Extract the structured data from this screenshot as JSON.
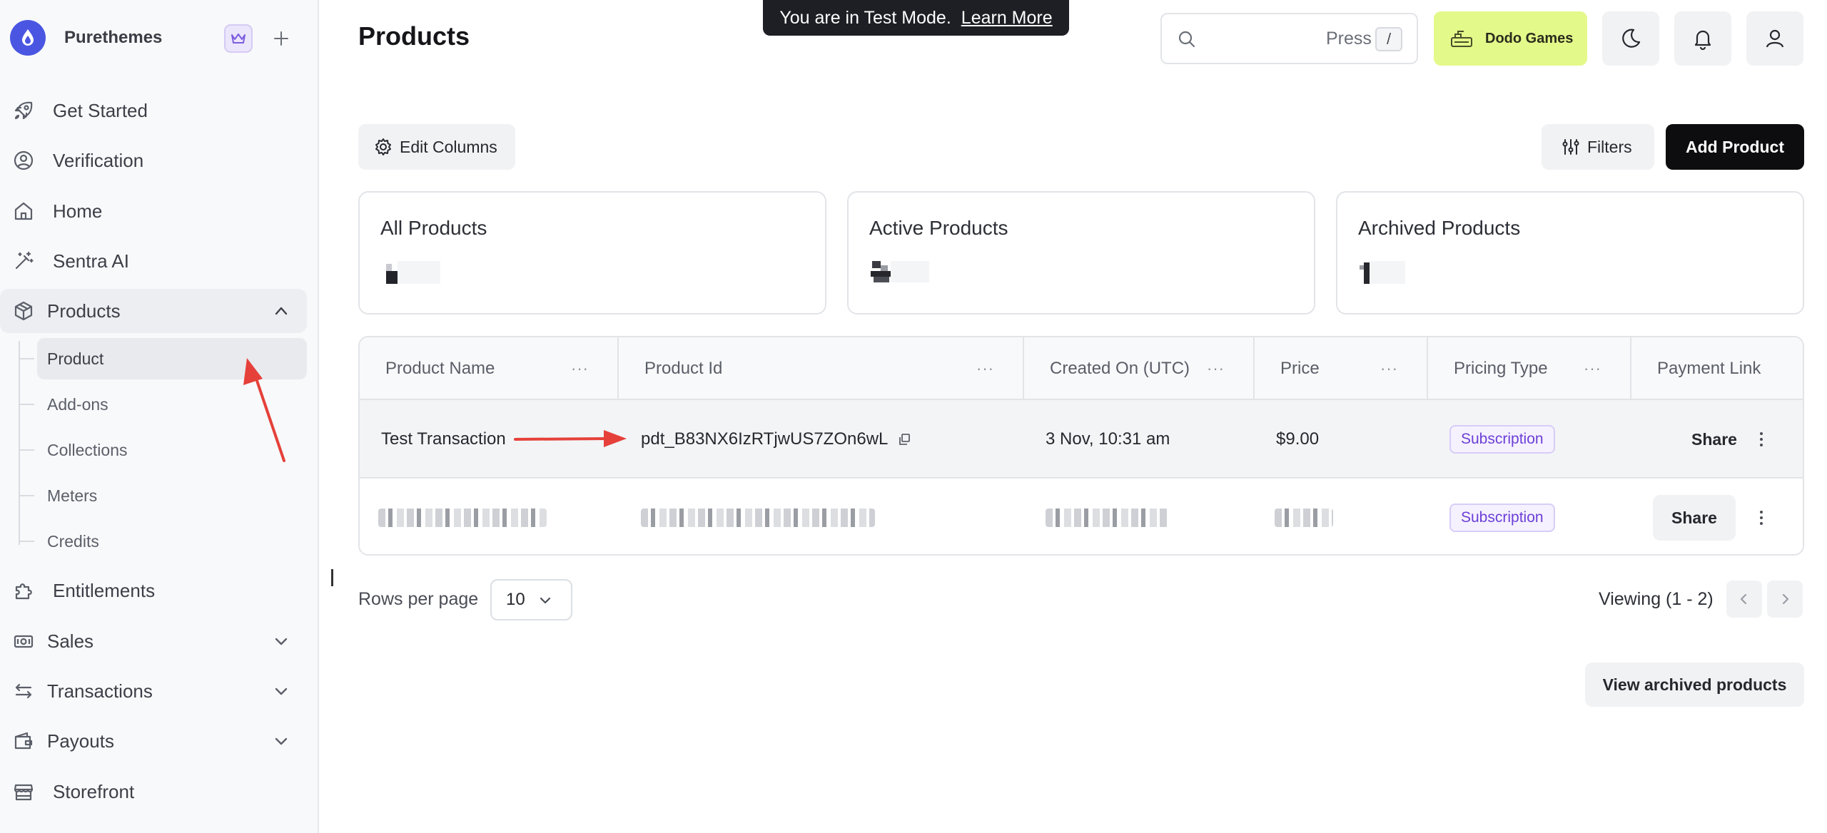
{
  "sidebar": {
    "brand_name": "Purethemes",
    "items": [
      {
        "label": "Get Started",
        "icon": "rocket-icon"
      },
      {
        "label": "Verification",
        "icon": "user-circle-icon"
      },
      {
        "label": "Home",
        "icon": "home-icon"
      },
      {
        "label": "Sentra AI",
        "icon": "magic-wand-icon"
      },
      {
        "label": "Products",
        "icon": "box-icon",
        "expanded": true
      },
      {
        "label": "Entitlements",
        "icon": "puzzle-icon"
      },
      {
        "label": "Sales",
        "icon": "money-icon"
      },
      {
        "label": "Transactions",
        "icon": "arrows-swap-icon"
      },
      {
        "label": "Payouts",
        "icon": "wallet-icon"
      },
      {
        "label": "Storefront",
        "icon": "store-icon"
      }
    ],
    "product_subitems": [
      "Product",
      "Add-ons",
      "Collections",
      "Meters",
      "Credits"
    ],
    "active_subitem": "Product"
  },
  "header": {
    "title": "Products",
    "test_mode_text": "You are in Test Mode.",
    "learn_more": "Learn More",
    "search_hint": "Press",
    "search_shortcut": "/",
    "business_name": "Dodo Games"
  },
  "toolbar": {
    "edit_columns": "Edit Columns",
    "filters": "Filters",
    "add_product": "Add Product"
  },
  "summary_cards": [
    {
      "title": "All Products"
    },
    {
      "title": "Active Products"
    },
    {
      "title": "Archived Products"
    }
  ],
  "table": {
    "columns": [
      "Product Name",
      "Product Id",
      "Created On (UTC)",
      "Price",
      "Pricing Type",
      "Payment Link"
    ],
    "rows": [
      {
        "name": "Test Transaction",
        "id": "pdt_B83NX6IzRTjwUS7ZOn6wL",
        "created": "3 Nov, 10:31 am",
        "price": "$9.00",
        "pricing_type": "Subscription",
        "link": "Share"
      },
      {
        "name": "",
        "id": "",
        "created": "",
        "price": "",
        "pricing_type": "Subscription",
        "link": "Share"
      }
    ]
  },
  "pagination": {
    "rows_label": "Rows per page",
    "rows_value": "10",
    "viewing": "Viewing (1 - 2)"
  },
  "view_archived": "View archived products",
  "colors": {
    "accent": "#4a56e2",
    "business_badge": "#e3f98a",
    "subscription_badge": "#6c3fd6",
    "annotation_arrow": "#e5413a"
  }
}
